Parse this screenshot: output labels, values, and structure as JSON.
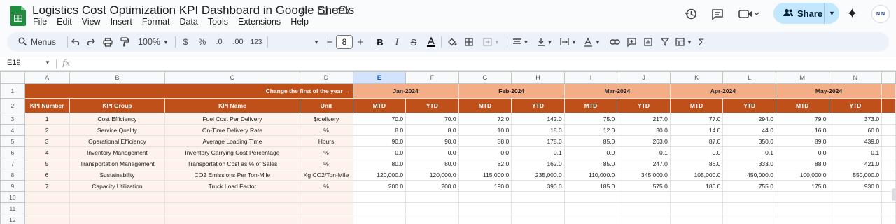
{
  "app": {
    "doc_title": "Logistics Cost Optimization KPI Dashboard in Google Sheets",
    "menu": [
      "File",
      "Edit",
      "View",
      "Insert",
      "Format",
      "Data",
      "Tools",
      "Extensions",
      "Help"
    ],
    "share_label": "Share",
    "avatar_text": "N N"
  },
  "toolbar": {
    "menus_label": "Menus",
    "zoom": "100%",
    "currency": "$",
    "percent": "%",
    "dec_decrease": ".0",
    "dec_increase": ".00",
    "number_format": "123",
    "font_size": "8"
  },
  "formula_bar": {
    "cell_ref": "E19",
    "fx": "fx",
    "value": ""
  },
  "sheet": {
    "columns": [
      "A",
      "B",
      "C",
      "D",
      "E",
      "F",
      "G",
      "H",
      "I",
      "J",
      "K",
      "L",
      "M",
      "N"
    ],
    "selected_column": "E",
    "row_numbers": [
      "1",
      "2",
      "3",
      "4",
      "5",
      "6",
      "7",
      "8",
      "9",
      "10",
      "11",
      "12"
    ],
    "note": "Change the first of the year →",
    "months": [
      "Jan-2024",
      "Feb-2024",
      "Mar-2024",
      "Apr-2024",
      "May-2024"
    ],
    "fixed_headers": [
      "KPI Number",
      "KPI Group",
      "KPI Name",
      "Unit"
    ],
    "period_headers": [
      "MTD",
      "YTD"
    ],
    "rows": [
      {
        "num": "1",
        "group": "Cost Efficiency",
        "name": "Fuel Cost Per Delivery",
        "unit": "$/delivery",
        "values": [
          "70.0",
          "70.0",
          "72.0",
          "142.0",
          "75.0",
          "217.0",
          "77.0",
          "294.0",
          "79.0",
          "373.0"
        ]
      },
      {
        "num": "2",
        "group": "Service Quality",
        "name": "On-Time Delivery Rate",
        "unit": "%",
        "values": [
          "8.0",
          "8.0",
          "10.0",
          "18.0",
          "12.0",
          "30.0",
          "14.0",
          "44.0",
          "16.0",
          "60.0"
        ]
      },
      {
        "num": "3",
        "group": "Operational Efficiency",
        "name": "Average Loading Time",
        "unit": "Hours",
        "values": [
          "90.0",
          "90.0",
          "88.0",
          "178.0",
          "85.0",
          "263.0",
          "87.0",
          "350.0",
          "89.0",
          "439.0"
        ]
      },
      {
        "num": "4",
        "group": "Inventory Management",
        "name": "Inventory Carrying Cost Percentage",
        "unit": "%",
        "values": [
          "0.0",
          "0.0",
          "0.0",
          "0.1",
          "0.0",
          "0.1",
          "0.0",
          "0.1",
          "0.0",
          "0.1"
        ]
      },
      {
        "num": "5",
        "group": "Transportation Management",
        "name": "Transportation Cost as % of Sales",
        "unit": "%",
        "values": [
          "80.0",
          "80.0",
          "82.0",
          "162.0",
          "85.0",
          "247.0",
          "86.0",
          "333.0",
          "88.0",
          "421.0"
        ]
      },
      {
        "num": "6",
        "group": "Sustainability",
        "name": "CO2 Emissions Per Ton-Mile",
        "unit": "Kg CO2/Ton-Mile",
        "values": [
          "120,000.0",
          "120,000.0",
          "115,000.0",
          "235,000.0",
          "110,000.0",
          "345,000.0",
          "105,000.0",
          "450,000.0",
          "100,000.0",
          "550,000.0"
        ]
      },
      {
        "num": "7",
        "group": "Capacity Utilization",
        "name": "Truck Load Factor",
        "unit": "%",
        "values": [
          "200.0",
          "200.0",
          "190.0",
          "390.0",
          "185.0",
          "575.0",
          "180.0",
          "755.0",
          "175.0",
          "930.0"
        ]
      }
    ]
  },
  "colors": {
    "header_dark": "#c0501a",
    "header_month": "#f4ae87",
    "left_fill": "#fdf2ec",
    "share_bg": "#c2e7ff",
    "selected_col": "#d3e3fd"
  }
}
